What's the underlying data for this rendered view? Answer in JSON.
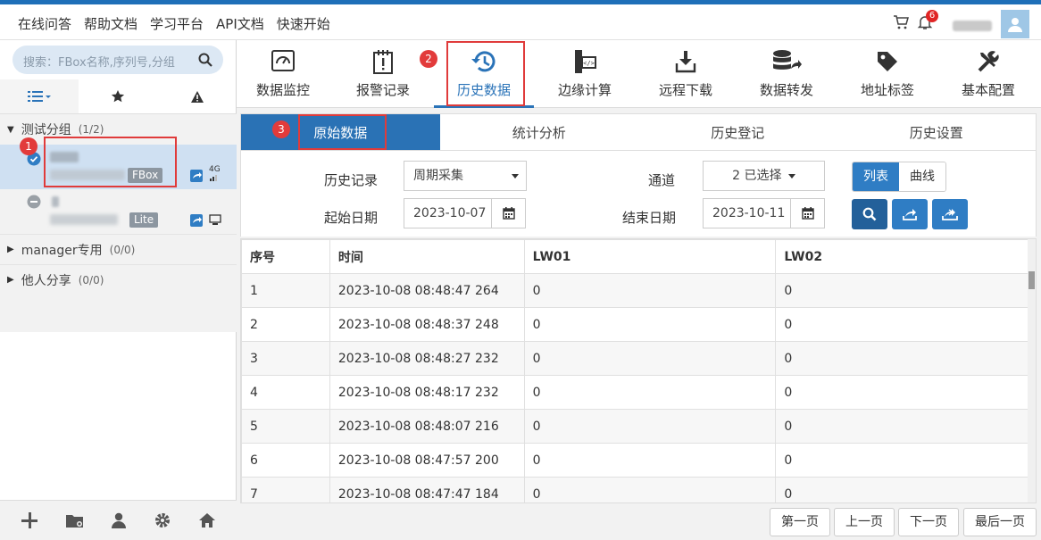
{
  "topnav": {
    "items": [
      "在线问答",
      "帮助文档",
      "学习平台",
      "API文档",
      "快速开始"
    ],
    "notification_count": "6"
  },
  "sidebar": {
    "search_placeholder": "搜索：FBox名称,序列号,分组",
    "groups": [
      {
        "name": "测试分组",
        "count": "(1/2)",
        "expanded": true
      },
      {
        "name": "manager专用",
        "count": "(0/0)",
        "expanded": false
      },
      {
        "name": "他人分享",
        "count": "(0/0)",
        "expanded": false
      }
    ],
    "devices": [
      {
        "tag": "FBox",
        "signal": "4G",
        "status": "online",
        "selected": true
      },
      {
        "tag": "Lite",
        "status": "offline",
        "selected": false
      }
    ]
  },
  "main_tabs": [
    {
      "label": "数据监控",
      "icon": "monitor-icon"
    },
    {
      "label": "报警记录",
      "icon": "alarm-clipboard-icon"
    },
    {
      "label": "历史数据",
      "icon": "history-clock-icon",
      "active": true
    },
    {
      "label": "边缘计算",
      "icon": "edge-compute-icon"
    },
    {
      "label": "远程下载",
      "icon": "download-icon"
    },
    {
      "label": "数据转发",
      "icon": "database-forward-icon"
    },
    {
      "label": "地址标签",
      "icon": "tag-icon"
    },
    {
      "label": "基本配置",
      "icon": "tools-icon"
    }
  ],
  "sub_tabs": [
    {
      "label": "原始数据",
      "active": true
    },
    {
      "label": "统计分析"
    },
    {
      "label": "历史登记"
    },
    {
      "label": "历史设置"
    }
  ],
  "annotations": {
    "n1": "1",
    "n2": "2",
    "n3": "3"
  },
  "filters": {
    "history_label": "历史记录",
    "history_value": "周期采集",
    "channel_label": "通道",
    "channel_value": "2 已选择",
    "start_label": "起始日期",
    "start_value": "2023-10-07",
    "end_label": "结束日期",
    "end_value": "2023-10-11",
    "view_list": "列表",
    "view_curve": "曲线"
  },
  "table": {
    "headers": [
      "序号",
      "时间",
      "LW01",
      "LW02"
    ],
    "rows": [
      [
        "1",
        "2023-10-08 08:48:47 264",
        "0",
        "0"
      ],
      [
        "2",
        "2023-10-08 08:48:37 248",
        "0",
        "0"
      ],
      [
        "3",
        "2023-10-08 08:48:27 232",
        "0",
        "0"
      ],
      [
        "4",
        "2023-10-08 08:48:17 232",
        "0",
        "0"
      ],
      [
        "5",
        "2023-10-08 08:48:07 216",
        "0",
        "0"
      ],
      [
        "6",
        "2023-10-08 08:47:57 200",
        "0",
        "0"
      ],
      [
        "7",
        "2023-10-08 08:47:47 184",
        "0",
        "0"
      ]
    ]
  },
  "pager": {
    "first": "第一页",
    "prev": "上一页",
    "next": "下一页",
    "last": "最后一页"
  },
  "colors": {
    "accent": "#2a73b8",
    "annotation_red": "#e03b3b",
    "online_blue": "#2f7dc4"
  }
}
